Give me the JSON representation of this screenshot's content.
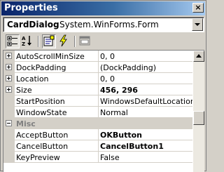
{
  "window": {
    "title": "Properties",
    "close_glyph": "×"
  },
  "object_selector": {
    "name": "CardDialog",
    "type": "System.WinForms.Form"
  },
  "toolbar": {
    "buttons": [
      {
        "name": "categorized-view-button",
        "icon": "categorized-icon",
        "pressed": true
      },
      {
        "name": "alphabetical-view-button",
        "icon": "alphabetical-sort-icon",
        "pressed": false
      },
      {
        "name": "properties-view-button",
        "icon": "properties-icon",
        "pressed": true
      },
      {
        "name": "events-view-button",
        "icon": "lightning-icon",
        "pressed": false
      },
      {
        "name": "property-pages-button",
        "icon": "property-pages-icon",
        "pressed": false
      }
    ]
  },
  "grid": {
    "rows": [
      {
        "kind": "prop",
        "name": "AutoScrollMinSize",
        "value": "0, 0",
        "expand": "plus",
        "bold": false
      },
      {
        "kind": "prop",
        "name": "DockPadding",
        "value": "(DockPadding)",
        "expand": "plus",
        "bold": false
      },
      {
        "kind": "prop",
        "name": "Location",
        "value": "0, 0",
        "expand": "plus",
        "bold": false
      },
      {
        "kind": "prop",
        "name": "Size",
        "value": "456, 296",
        "expand": "plus",
        "bold": true
      },
      {
        "kind": "prop",
        "name": "StartPosition",
        "value": "WindowsDefaultLocation",
        "expand": "",
        "bold": false
      },
      {
        "kind": "prop",
        "name": "WindowState",
        "value": "Normal",
        "expand": "",
        "bold": false
      },
      {
        "kind": "category",
        "name": "Misc",
        "expand": "minus"
      },
      {
        "kind": "prop",
        "name": "AcceptButton",
        "value": "OKButton",
        "expand": "",
        "bold": true
      },
      {
        "kind": "prop",
        "name": "CancelButton",
        "value": "CancelButton1",
        "expand": "",
        "bold": true
      },
      {
        "kind": "prop",
        "name": "KeyPreview",
        "value": "False",
        "expand": "",
        "bold": false
      }
    ]
  },
  "colors": {
    "title_gradient_start": "#0a246a",
    "title_gradient_end": "#a6caf0",
    "category_text": "#808080",
    "face": "#d4d0c8"
  }
}
